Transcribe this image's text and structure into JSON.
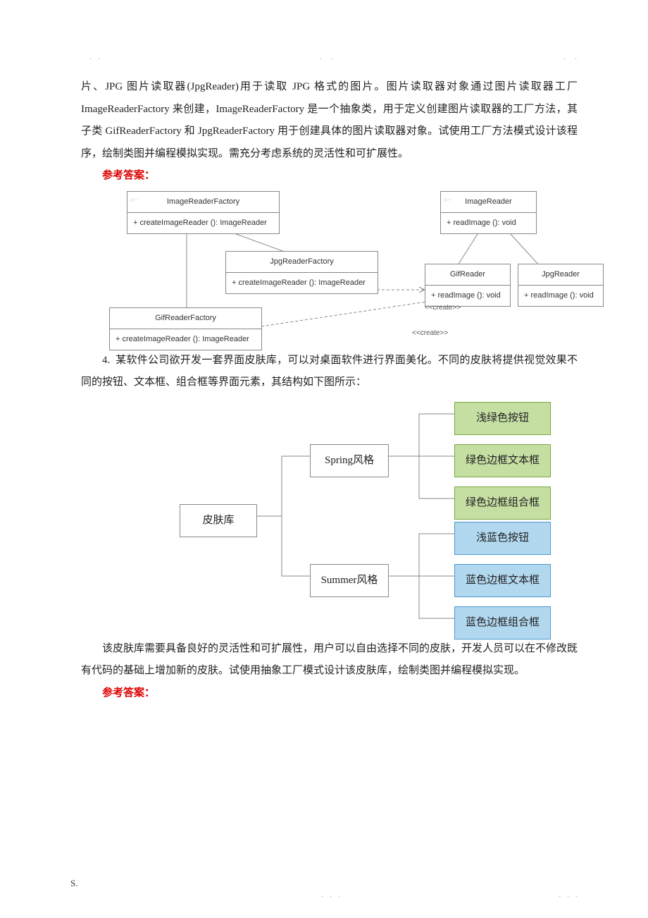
{
  "p1": "片、JPG 图片读取器(JpgReader)用于读取 JPG 格式的图片。图片读取器对象通过图片读取器工厂 ImageReaderFactory 来创建，ImageReaderFactory 是一个抽象类，用于定义创建图片读取器的工厂方法，其子类 GifReaderFactory 和 JpgReaderFactory 用于创建具体的图片读取器对象。试使用工厂方法模式设计该程序，绘制类图并编程模拟实现。需充分考虑系统的灵活性和可扩展性。",
  "answer_label": "参考答案：",
  "uml": {
    "image_reader_factory": "ImageReaderFactory",
    "create": "+ createImageReader (): ImageReader",
    "image_reader": "ImageReader",
    "read": "+ readImage (): void",
    "jpg_factory": "JpgReaderFactory",
    "gif_factory": "GifReaderFactory",
    "gif_reader": "GifReader",
    "jpg_reader": "JpgReader",
    "create_stereo": "<<create>>"
  },
  "q4_num": "4.",
  "q4_a": "某软件公司欲开发一套界面皮肤库，可以对桌面软件进行界面美化。不同的皮肤将提供视觉效果不同的按钮、文本框、组合框等界面元素，其结构如下图所示：",
  "tree": {
    "root": "皮肤库",
    "spring": "Spring风格",
    "summer": "Summer风格",
    "g_btn": "浅绿色按钮",
    "g_txt": "绿色边框文本框",
    "g_cmb": "绿色边框组合框",
    "b_btn": "浅蓝色按钮",
    "b_txt": "蓝色边框文本框",
    "b_cmb": "蓝色边框组合框"
  },
  "q4_b": "该皮肤库需要具备良好的灵活性和可扩展性，用户可以自由选择不同的皮肤，开发人员可以在不修改既有代码的基础上增加新的皮肤。试使用抽象工厂模式设计该皮肤库，绘制类图并编程模拟实现。",
  "footer_s": "S."
}
